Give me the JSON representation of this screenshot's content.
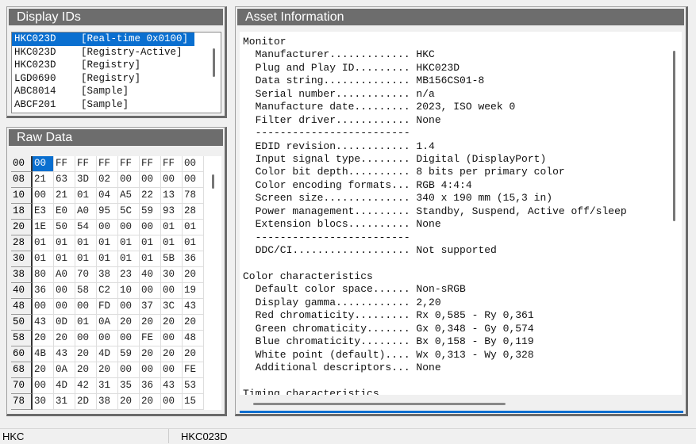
{
  "display_ids": {
    "title": "Display IDs",
    "items": [
      {
        "id": "HKC023D",
        "source": "[Real-time 0x0100]",
        "selected": true
      },
      {
        "id": "HKC023D",
        "source": "[Registry-Active]"
      },
      {
        "id": "HKC023D",
        "source": "[Registry]"
      },
      {
        "id": "LGD0690",
        "source": "[Registry]"
      },
      {
        "id": "ABC8014",
        "source": "[Sample]"
      },
      {
        "id": "ABCF201",
        "source": "[Sample]"
      }
    ]
  },
  "raw_data": {
    "title": "Raw Data",
    "rows": [
      {
        "addr": "00",
        "bytes": [
          "00",
          "FF",
          "FF",
          "FF",
          "FF",
          "FF",
          "FF",
          "00"
        ]
      },
      {
        "addr": "08",
        "bytes": [
          "21",
          "63",
          "3D",
          "02",
          "00",
          "00",
          "00",
          "00"
        ]
      },
      {
        "addr": "10",
        "bytes": [
          "00",
          "21",
          "01",
          "04",
          "A5",
          "22",
          "13",
          "78"
        ]
      },
      {
        "addr": "18",
        "bytes": [
          "E3",
          "E0",
          "A0",
          "95",
          "5C",
          "59",
          "93",
          "28"
        ]
      },
      {
        "addr": "20",
        "bytes": [
          "1E",
          "50",
          "54",
          "00",
          "00",
          "00",
          "01",
          "01"
        ]
      },
      {
        "addr": "28",
        "bytes": [
          "01",
          "01",
          "01",
          "01",
          "01",
          "01",
          "01",
          "01"
        ]
      },
      {
        "addr": "30",
        "bytes": [
          "01",
          "01",
          "01",
          "01",
          "01",
          "01",
          "5B",
          "36"
        ]
      },
      {
        "addr": "38",
        "bytes": [
          "80",
          "A0",
          "70",
          "38",
          "23",
          "40",
          "30",
          "20"
        ]
      },
      {
        "addr": "40",
        "bytes": [
          "36",
          "00",
          "58",
          "C2",
          "10",
          "00",
          "00",
          "19"
        ]
      },
      {
        "addr": "48",
        "bytes": [
          "00",
          "00",
          "00",
          "FD",
          "00",
          "37",
          "3C",
          "43"
        ]
      },
      {
        "addr": "50",
        "bytes": [
          "43",
          "0D",
          "01",
          "0A",
          "20",
          "20",
          "20",
          "20"
        ]
      },
      {
        "addr": "58",
        "bytes": [
          "20",
          "20",
          "00",
          "00",
          "00",
          "FE",
          "00",
          "48"
        ]
      },
      {
        "addr": "60",
        "bytes": [
          "4B",
          "43",
          "20",
          "4D",
          "59",
          "20",
          "20",
          "20"
        ]
      },
      {
        "addr": "68",
        "bytes": [
          "20",
          "0A",
          "20",
          "20",
          "00",
          "00",
          "00",
          "FE"
        ]
      },
      {
        "addr": "70",
        "bytes": [
          "00",
          "4D",
          "42",
          "31",
          "35",
          "36",
          "43",
          "53"
        ]
      },
      {
        "addr": "78",
        "bytes": [
          "30",
          "31",
          "2D",
          "38",
          "20",
          "20",
          "00",
          "15"
        ]
      }
    ]
  },
  "asset": {
    "title": "Asset Information",
    "lines": [
      "Monitor",
      "  Manufacturer............. HKC",
      "  Plug and Play ID......... HKC023D",
      "  Data string.............. MB156CS01-8",
      "  Serial number............ n/a",
      "  Manufacture date......... 2023, ISO week 0",
      "  Filter driver............ None",
      "  -------------------------",
      "  EDID revision............ 1.4",
      "  Input signal type........ Digital (DisplayPort)",
      "  Color bit depth.......... 8 bits per primary color",
      "  Color encoding formats... RGB 4:4:4",
      "  Screen size.............. 340 x 190 mm (15,3 in)",
      "  Power management......... Standby, Suspend, Active off/sleep",
      "  Extension blocs.......... None",
      "  -------------------------",
      "  DDC/CI................... Not supported",
      "",
      "Color characteristics",
      "  Default color space...... Non-sRGB",
      "  Display gamma............ 2,20",
      "  Red chromaticity......... Rx 0,585 - Ry 0,361",
      "  Green chromaticity....... Gx 0,348 - Gy 0,574",
      "  Blue chromaticity........ Bx 0,158 - By 0,119",
      "  White point (default).... Wx 0,313 - Wy 0,328",
      "  Additional descriptors... None",
      "",
      "Timing characteristics"
    ]
  },
  "status": {
    "left": "HKC",
    "right": "HKC023D"
  }
}
